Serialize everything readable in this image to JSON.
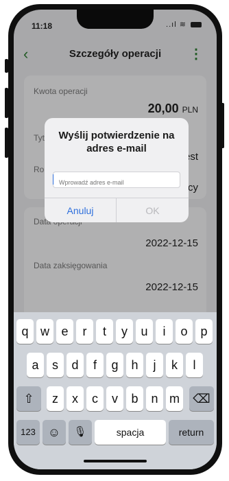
{
  "status_bar": {
    "time": "11:18",
    "signal": "..ıl",
    "wifi": "≋"
  },
  "nav": {
    "title": "Szczegóły operacji",
    "back_icon": "chevron-left-icon",
    "menu_icon": "kebab-icon"
  },
  "card1": {
    "amount_label": "Kwota operacji",
    "amount_value": "20,00",
    "amount_currency": "PLN",
    "title_label_fragment": "Tyt",
    "title_value_fragment": "est",
    "type_label_fragment": "Ro",
    "type_value_fragment": "ący"
  },
  "card2": {
    "date_label": "Data operacji",
    "date_value": "2022-12-15",
    "booking_label": "Data zaksięgowania",
    "booking_value": "2022-12-15"
  },
  "dialog": {
    "title": "Wyślij potwierdzenie na adres e-mail",
    "input_placeholder": "Wprowadź adres e-mail",
    "cancel_label": "Anuluj",
    "ok_label": "OK"
  },
  "keyboard": {
    "row1": [
      "q",
      "w",
      "e",
      "r",
      "t",
      "y",
      "u",
      "i",
      "o",
      "p"
    ],
    "row2": [
      "a",
      "s",
      "d",
      "f",
      "g",
      "h",
      "j",
      "k",
      "l"
    ],
    "row3": [
      "z",
      "x",
      "c",
      "v",
      "b",
      "n",
      "m"
    ],
    "shift": "⇧",
    "backspace": "⌫",
    "numbers": "123",
    "emoji": "☺",
    "mic": "🎙",
    "space": "spacja",
    "return": "return"
  },
  "colors": {
    "accent": "#2e7d32",
    "link_blue": "#2e6fdc"
  }
}
